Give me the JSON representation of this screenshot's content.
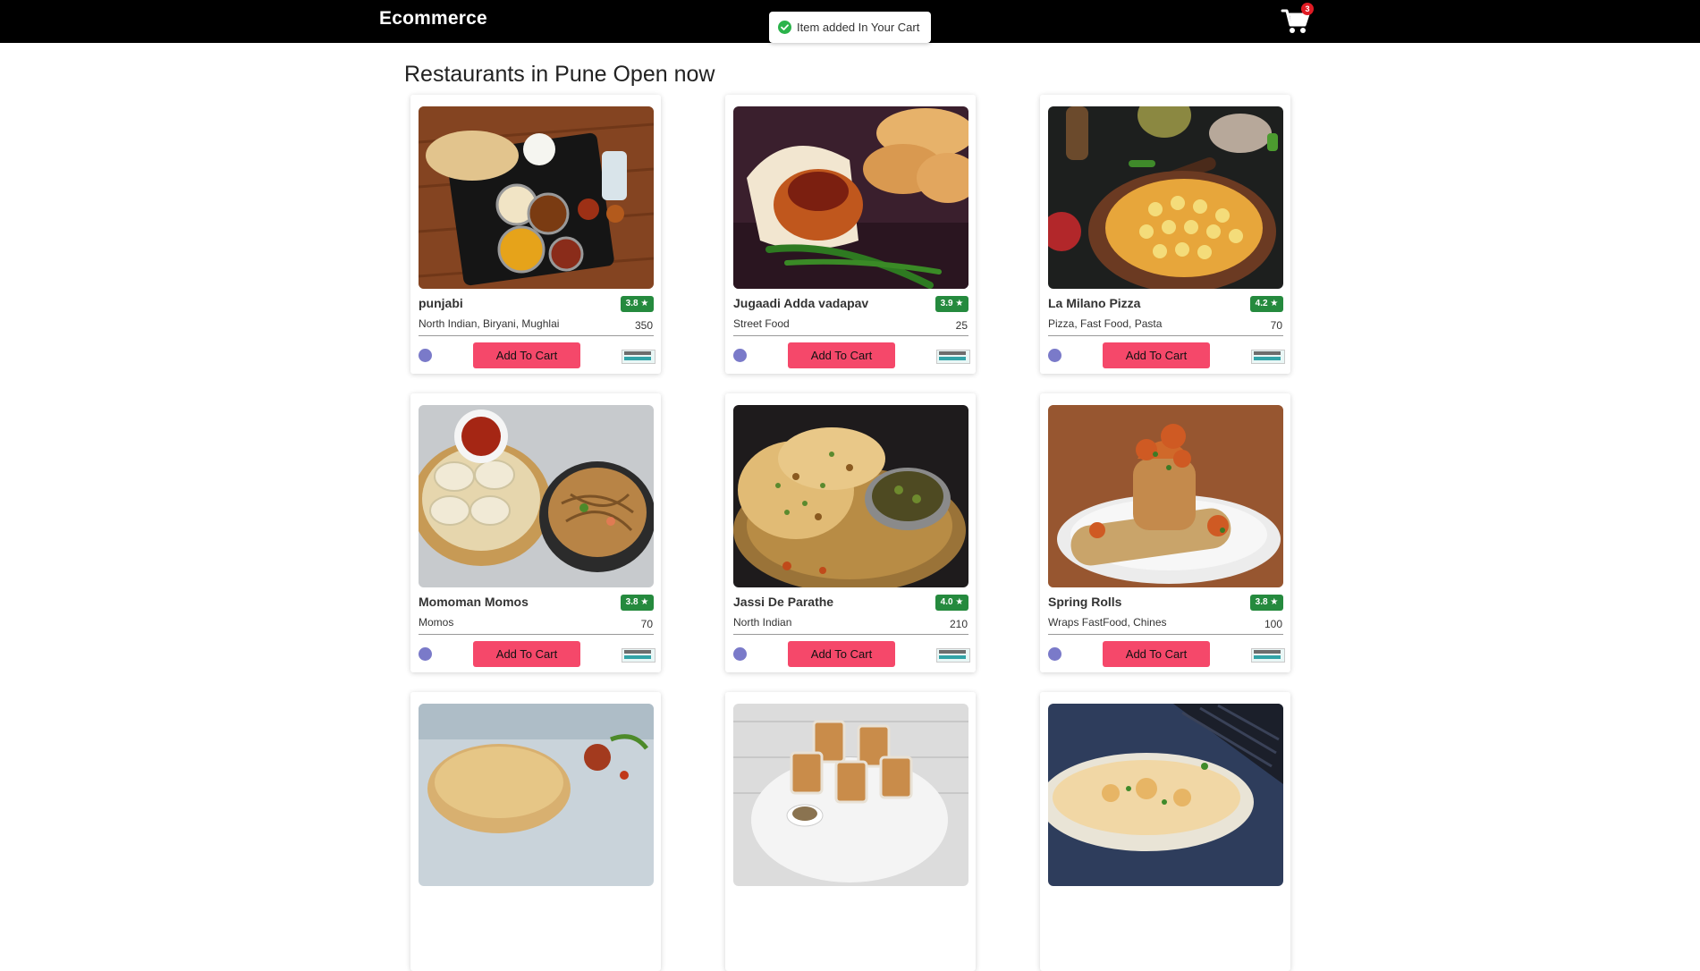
{
  "header": {
    "brand": "Ecommerce",
    "cart_count": "3"
  },
  "toast": {
    "message": "Item added In Your Cart"
  },
  "page": {
    "heading": "Restaurants in Pune Open now"
  },
  "cards": [
    {
      "name": "punjabi",
      "rating": "3.8 ★",
      "cuisine": "North Indian, Biryani, Mughlai",
      "price": "350",
      "button": "Add To Cart",
      "image": "thali-image"
    },
    {
      "name": "Jugaadi Adda vadapav",
      "rating": "3.9 ★",
      "cuisine": "Street Food",
      "price": "25",
      "button": "Add To Cart",
      "image": "vadapav-image"
    },
    {
      "name": "La Milano Pizza",
      "rating": "4.2 ★",
      "cuisine": "Pizza, Fast Food, Pasta",
      "price": "70",
      "button": "Add To Cart",
      "image": "pizza-image"
    },
    {
      "name": "Momoman Momos",
      "rating": "3.8 ★",
      "cuisine": "Momos",
      "price": "70",
      "button": "Add To Cart",
      "image": "momos-image"
    },
    {
      "name": "Jassi De Parathe",
      "rating": "4.0 ★",
      "cuisine": "North Indian",
      "price": "210",
      "button": "Add To Cart",
      "image": "paratha-image"
    },
    {
      "name": "Spring Rolls",
      "rating": "3.8 ★",
      "cuisine": "Wraps FastFood, Chines",
      "price": "100",
      "button": "Add To Cart",
      "image": "spring-roll-image"
    },
    {
      "name": "",
      "rating": "",
      "cuisine": "",
      "price": "",
      "button": "",
      "image": "kachori-image"
    },
    {
      "name": "",
      "rating": "",
      "cuisine": "",
      "price": "",
      "button": "",
      "image": "chai-image"
    },
    {
      "name": "",
      "rating": "",
      "cuisine": "",
      "price": "",
      "button": "",
      "image": "dosa-image"
    }
  ],
  "colors": {
    "navbar": "#000000",
    "rating_badge": "#258a3e",
    "cart_button": "#f5486a",
    "cart_count_badge": "#e01b24",
    "toast_success": "#2bb34b"
  },
  "icons": {
    "cart": "shopping-cart-icon",
    "toast": "check-circle-icon",
    "trend": "trending-icon",
    "safety": "max-safety-delivery-icon"
  }
}
